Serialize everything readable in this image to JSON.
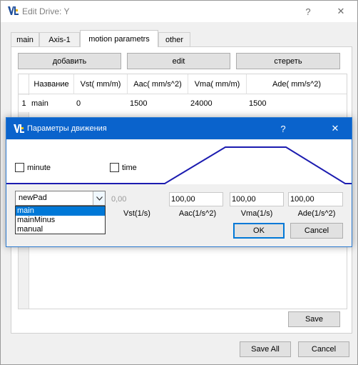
{
  "window": {
    "title": "Edit Drive: Y",
    "help_label": "?",
    "close_label": "✕"
  },
  "tabs": [
    {
      "label": "main"
    },
    {
      "label": "Axis-1"
    },
    {
      "label": "motion parametrs",
      "active": true
    },
    {
      "label": "other"
    }
  ],
  "toolbar": {
    "add_label": "добавить",
    "edit_label": "edit",
    "delete_label": "стереть"
  },
  "table": {
    "columns": [
      "Название",
      "Vst( mm/m)",
      "Aac( mm/s^2)",
      "Vma( mm/m)",
      "Ade( mm/s^2)"
    ],
    "rows": [
      {
        "num": "1",
        "cells": [
          "main",
          "0",
          "1500",
          "24000",
          "1500"
        ]
      }
    ]
  },
  "panel_save_label": "Save",
  "footer": {
    "save_all_label": "Save All",
    "cancel_label": "Cancel"
  },
  "dialog": {
    "title": "Параметры движения",
    "help_label": "?",
    "close_label": "✕",
    "checkboxes": {
      "minute": "minute",
      "time": "time"
    },
    "profile": {
      "selected": "newPad",
      "options": [
        "main",
        "mainMinus",
        "manual"
      ],
      "highlighted": "main"
    },
    "vst_value": "0,00",
    "fields": {
      "aac": "100,00",
      "vma": "100,00",
      "ade": "100,00"
    },
    "labels": {
      "vst": "Vst(1/s)",
      "aac": "Aac(1/s^2)",
      "vma": "Vma(1/s)",
      "ade": "Ade(1/s^2)"
    },
    "ok_label": "OK",
    "cancel_label": "Cancel",
    "accent_color": "#0a63cc",
    "profile_line_color": "#1c1cb0"
  }
}
